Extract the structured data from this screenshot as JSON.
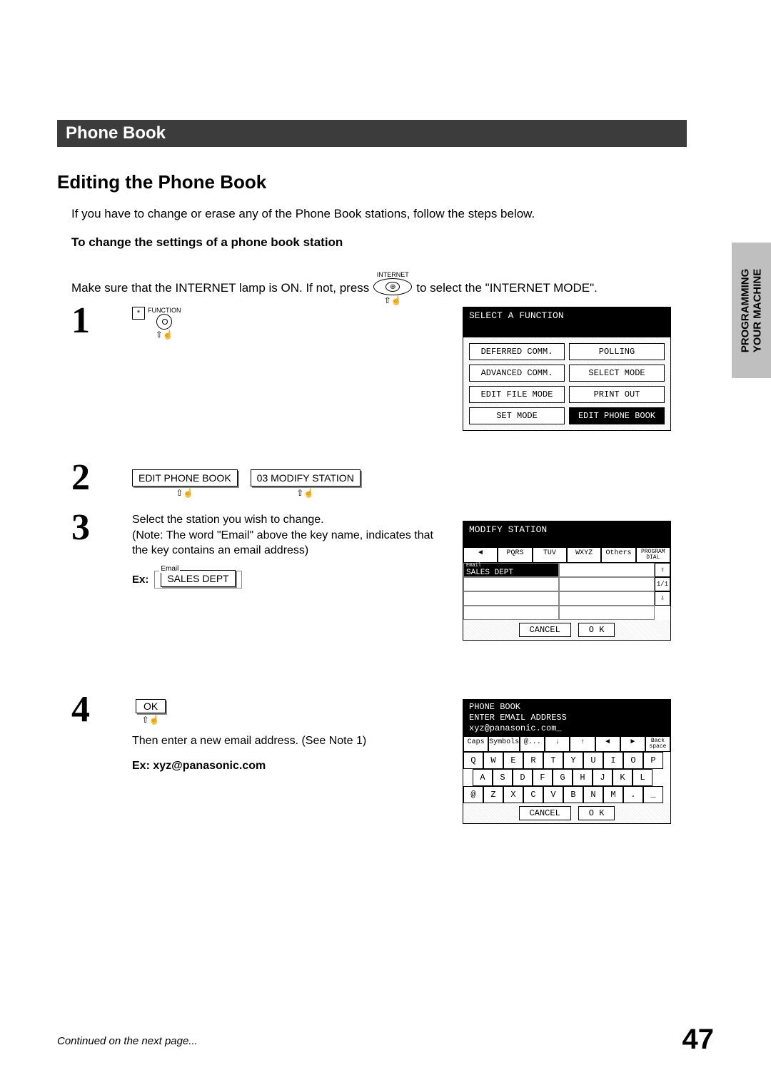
{
  "side_tab": "PROGRAMMING\nYOUR MACHINE",
  "section_title": "Phone Book",
  "subheading": "Editing the Phone Book",
  "intro_text": "If you have to change or erase any of the Phone Book stations, follow the steps below.",
  "subhead2": "To change the settings of a phone book station",
  "line_before_btn": "Make sure that the INTERNET lamp is ON.  If not, press",
  "line_after_btn": "to select the \"INTERNET MODE\".",
  "internet_label": "INTERNET",
  "function_label": "FUNCTION",
  "asterisk": "*",
  "screen1": {
    "title": "SELECT A FUNCTION",
    "cells": [
      "DEFERRED COMM.",
      "POLLING",
      "ADVANCED COMM.",
      "SELECT MODE",
      "EDIT FILE MODE",
      "PRINT OUT",
      "SET MODE",
      "EDIT PHONE BOOK"
    ],
    "selected_index": 7
  },
  "step2": {
    "btn1": "EDIT PHONE BOOK",
    "btn2": "03 MODIFY STATION"
  },
  "step3": {
    "text": "Select the station you wish to change.\n(Note:  The word \"Email\" above the key name, indicates that the key contains an email address)",
    "ex_label": "Ex:",
    "ex_legend": "Email",
    "ex_value": "SALES DEPT"
  },
  "screen3": {
    "title": "MODIFY STATION",
    "tabs": [
      "◄",
      "PQRS",
      "TUV",
      "WXYZ",
      "Others",
      "PROGRAM DIAL"
    ],
    "selected_cell_legend": "Email",
    "selected_cell": "SALES DEPT",
    "scroll_up": "⇧",
    "page": "1/1",
    "scroll_down": "⇩",
    "cancel": "CANCEL",
    "ok": "O K"
  },
  "step4": {
    "ok_btn": "OK",
    "then_text": "Then enter a new email address.  (See Note 1)",
    "ex_text": "Ex: xyz@panasonic.com"
  },
  "screen4": {
    "title_line1": "PHONE BOOK",
    "title_line2": "ENTER EMAIL ADDRESS",
    "title_line3": "xyz@panasonic.com_",
    "tools": [
      "Caps",
      "Symbols",
      "@...",
      "↓",
      "↑",
      "◄",
      "►",
      "Back space"
    ],
    "row1": [
      "Q",
      "W",
      "E",
      "R",
      "T",
      "Y",
      "U",
      "I",
      "O",
      "P"
    ],
    "row2": [
      "A",
      "S",
      "D",
      "F",
      "G",
      "H",
      "J",
      "K",
      "L"
    ],
    "row3": [
      "@",
      "Z",
      "X",
      "C",
      "V",
      "B",
      "N",
      "M",
      ".",
      "_"
    ],
    "cancel": "CANCEL",
    "ok": "O K"
  },
  "continued": "Continued on the next page...",
  "page_number": "47"
}
